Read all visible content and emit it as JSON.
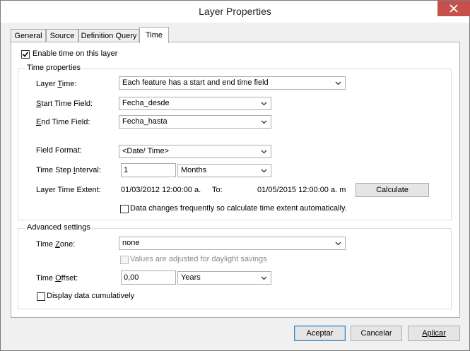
{
  "window": {
    "title": "Layer Properties"
  },
  "tabs": [
    {
      "label": "General"
    },
    {
      "label": "Source"
    },
    {
      "label": "Definition Query"
    },
    {
      "label": "Time",
      "active": true
    }
  ],
  "enable_time": {
    "label": "Enable time on this layer",
    "checked": true
  },
  "time_properties": {
    "legend": "Time properties",
    "layer_time": {
      "label": "Layer Time:",
      "value": "Each feature has a start and end time field"
    },
    "start_time_field": {
      "label": "Start Time Field:",
      "value": "Fecha_desde"
    },
    "end_time_field": {
      "label": "End Time Field:",
      "value": "Fecha_hasta"
    },
    "field_format": {
      "label": "Field Format:",
      "value": "<Date/ Time>"
    },
    "time_step_interval": {
      "label": "Time Step Interval:",
      "value": "1",
      "unit": "Months"
    },
    "layer_time_extent": {
      "label": "Layer Time Extent:",
      "start": "01/03/2012 12:00:00 a.",
      "to_label": "To:",
      "end": "01/05/2015 12:00:00 a. m",
      "calculate_label": "Calculate"
    },
    "data_changes": {
      "label": "Data changes frequently so calculate time extent automatically.",
      "checked": false
    }
  },
  "advanced": {
    "legend": "Advanced settings",
    "time_zone": {
      "label": "Time Zone:",
      "value": "none"
    },
    "daylight": {
      "label": "Values are adjusted for daylight savings",
      "checked": false,
      "disabled": true
    },
    "time_offset": {
      "label": "Time Offset:",
      "value": "0,00",
      "unit": "Years"
    },
    "cumulative": {
      "label": "Display data cumulatively",
      "checked": false
    }
  },
  "buttons": {
    "ok": "Aceptar",
    "cancel": "Cancelar",
    "apply": "Aplicar"
  },
  "colors": {
    "close_button": "#c7504c",
    "default_button_border": "#3c7fb1"
  }
}
